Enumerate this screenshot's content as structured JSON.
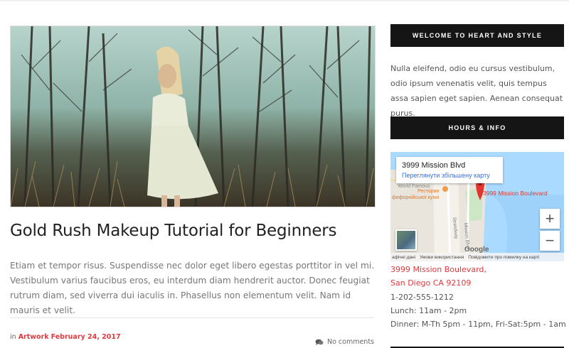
{
  "post": {
    "title": "Gold Rush Makeup Tutorial for Beginners",
    "excerpt": "Etiam et tempor risus. Suspendisse nec dolor eget libero egestas porttitor in vel mi. Vestibulum varius faucibus eros, eu interdum diam hendrerit auctor. Donec feugiat rutrum diam, sed viverra dui iaculis in. Phasellus non elementum velit. Nam id mauris et velit.",
    "meta_prefix": "in",
    "category": "Artwork",
    "date": "February 24, 2017",
    "comments": "No comments"
  },
  "sidebar": {
    "welcome": {
      "heading": "WELCOME TO HEART AND STYLE",
      "text": "Nulla eleifend, odio eu cursus vestibulum, odio ipsum venenatis velit, quis tempus assa sapien eget sapien. Aenean consequat purus."
    },
    "hours": {
      "heading": "HOURS & INFO",
      "map": {
        "card_address": "3999 Mission Blvd",
        "card_link": "Переглянути збільшену карту",
        "marker_label": "3999 Mission Boulevard",
        "labels": [
          "World Famous",
          "Ресторан",
          "фифорнійської кухні",
          "Strandway",
          "Mission Blvd"
        ],
        "zoom_in": "+",
        "zoom_out": "−",
        "footer": [
          "афічні дані",
          "Умови використання",
          "Повідомити про помилку на карті"
        ],
        "google": "Google"
      },
      "address_line1": "3999 Mission Boulevard,",
      "address_line2": "San Diego CA 92109",
      "phone": "1-202-555-1212",
      "lunch": "Lunch: 11am - 2pm",
      "dinner": "Dinner: M-Th 5pm - 11pm, Fri-Sat:5pm - 1am"
    }
  },
  "colors": {
    "accent": "#e0393e",
    "widget_heading_bg": "#151515",
    "map_water": "#aadaff"
  }
}
